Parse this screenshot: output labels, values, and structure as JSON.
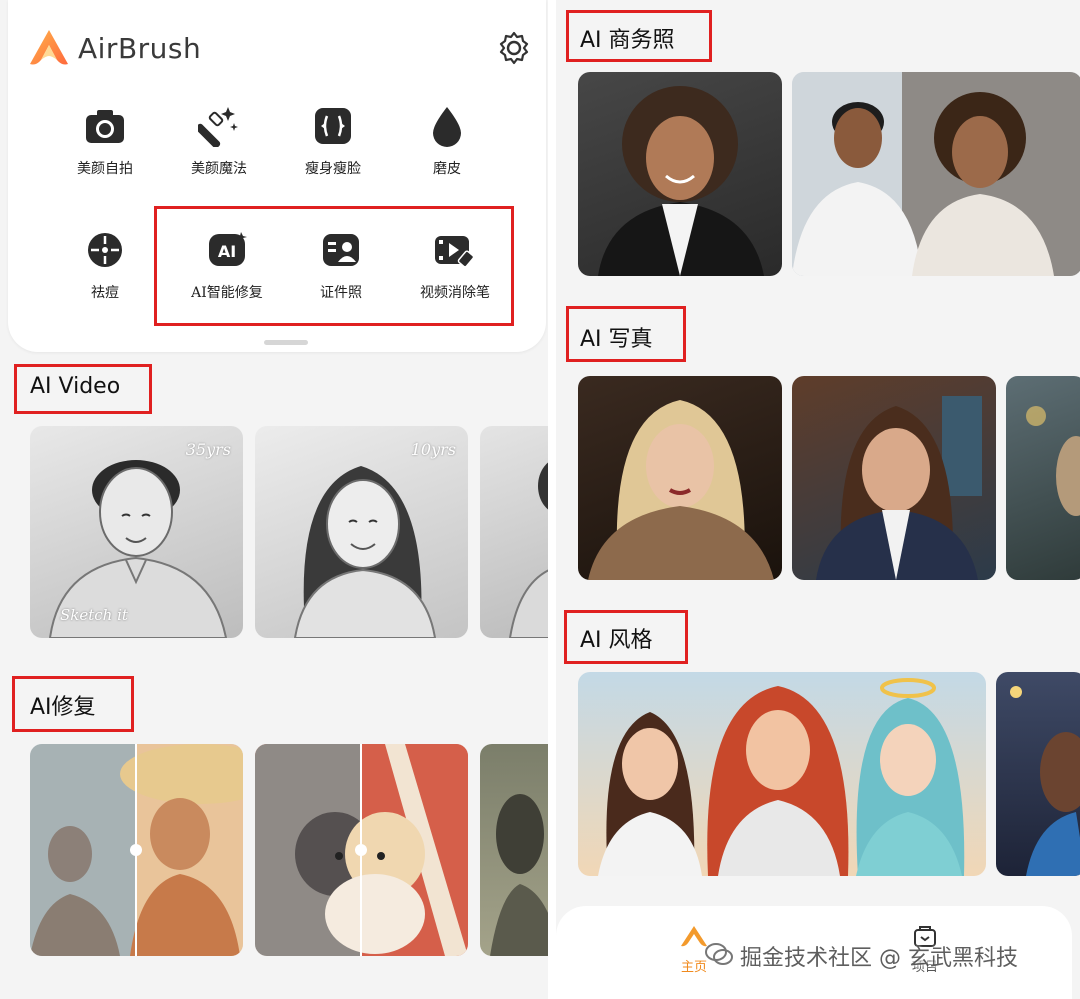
{
  "app": {
    "name": "AirBrush"
  },
  "tools_row1": [
    {
      "label": "美颜自拍",
      "icon": "camera-icon"
    },
    {
      "label": "美颜魔法",
      "icon": "magic-wand-icon"
    },
    {
      "label": "瘦身瘦脸",
      "icon": "slim-icon"
    },
    {
      "label": "磨皮",
      "icon": "drop-icon"
    }
  ],
  "tools_row2": [
    {
      "label": "祛痘",
      "icon": "acne-icon"
    },
    {
      "label": "AI智能修复",
      "icon": "ai-repair-icon"
    },
    {
      "label": "证件照",
      "icon": "id-photo-icon"
    },
    {
      "label": "视频消除笔",
      "icon": "video-eraser-icon"
    }
  ],
  "sections_left": {
    "ai_video": "AI Video",
    "ai_repair": "AI修复"
  },
  "video_badges": [
    "35yrs",
    "10yrs"
  ],
  "video_caption": "Sketch it",
  "sections_right": {
    "business": "AI 商务照",
    "portrait": "AI 写真",
    "style": "AI 风格"
  },
  "bottom_nav": {
    "home": "主页",
    "projects": "项目"
  },
  "watermark": "掘金技术社区 @ 玄武黑科技",
  "colors": {
    "accent": "#f08a1e",
    "highlight": "#e02020",
    "background": "#f4f4f4"
  }
}
